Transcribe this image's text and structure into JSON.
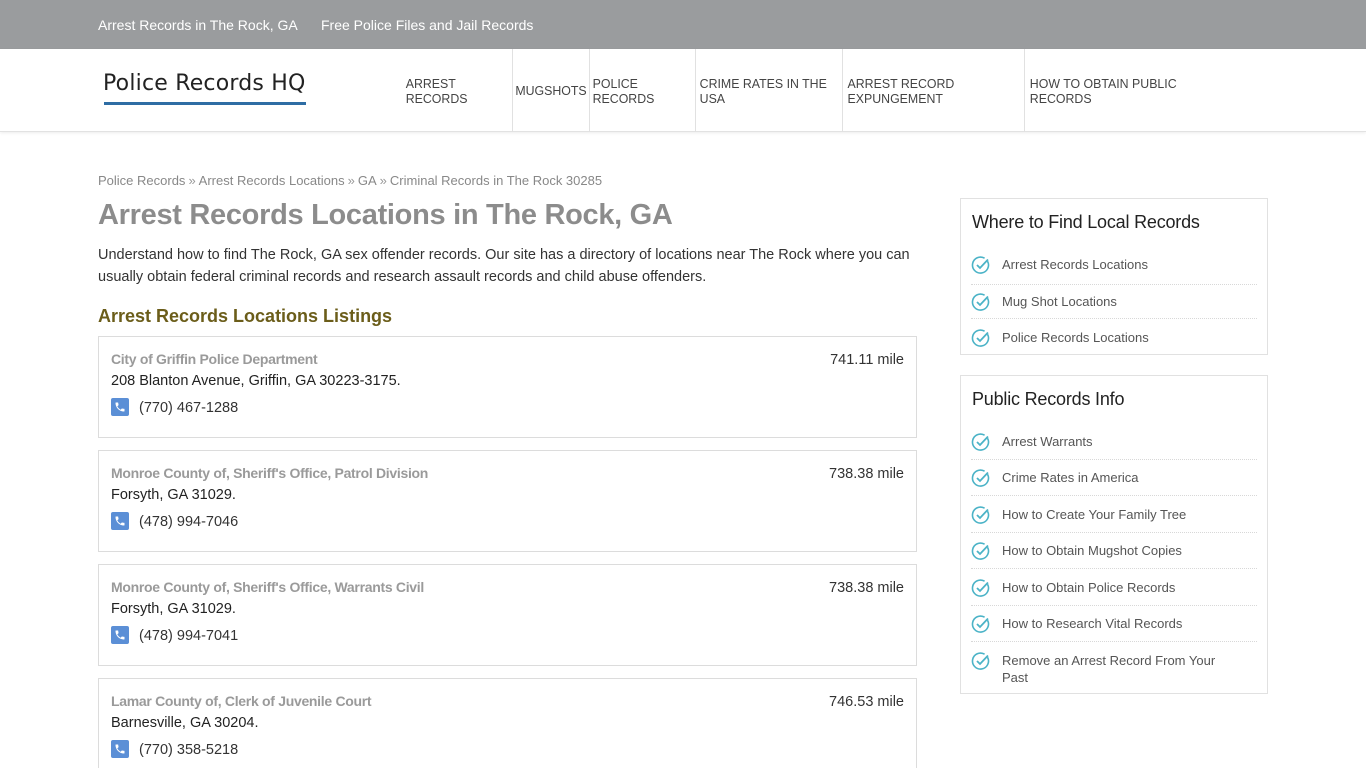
{
  "topbar": {
    "link1": "Arrest Records in The Rock, GA",
    "link2": "Free Police Files and Jail Records"
  },
  "header": {
    "logo": "Police Records HQ",
    "nav": [
      "ARREST RECORDS",
      "MUGSHOTS",
      "POLICE RECORDS",
      "CRIME RATES IN THE USA",
      "ARREST RECORD EXPUNGEMENT",
      "HOW TO OBTAIN PUBLIC RECORDS"
    ]
  },
  "breadcrumb": {
    "items": [
      "Police Records",
      "Arrest Records Locations",
      "GA",
      "Criminal Records in The Rock 30285"
    ],
    "separator": "»"
  },
  "main": {
    "title": "Arrest Records Locations in The Rock, GA",
    "intro": "Understand how to find The Rock, GA sex offender records. Our site has a directory of locations near The Rock where you can usually obtain federal criminal records and research assault records and child abuse offenders.",
    "listings_title": "Arrest Records Locations Listings",
    "listings": [
      {
        "name": "City of Griffin Police Department",
        "address": "208 Blanton Avenue, Griffin, GA 30223-3175.",
        "phone": "(770) 467-1288",
        "distance": "741.11 mile"
      },
      {
        "name": "Monroe County of, Sheriff's Office, Patrol Division",
        "address": "Forsyth, GA 31029.",
        "phone": "(478) 994-7046",
        "distance": "738.38 mile"
      },
      {
        "name": "Monroe County of, Sheriff's Office, Warrants Civil",
        "address": "Forsyth, GA 31029.",
        "phone": "(478) 994-7041",
        "distance": "738.38 mile"
      },
      {
        "name": "Lamar County of, Clerk of Juvenile Court",
        "address": "Barnesville, GA 30204.",
        "phone": "(770) 358-5218",
        "distance": "746.53 mile"
      }
    ]
  },
  "sidebar": {
    "local": {
      "title": "Where to Find Local Records",
      "items": [
        "Arrest Records Locations",
        "Mug Shot Locations",
        "Police Records Locations"
      ]
    },
    "info": {
      "title": "Public Records Info",
      "items": [
        "Arrest Warrants",
        "Crime Rates in America",
        "How to Create Your Family Tree",
        "How to Obtain Mugshot Copies",
        "How to Obtain Police Records",
        "How to Research Vital Records",
        "Remove an Arrest Record From Your Past"
      ]
    }
  },
  "colors": {
    "topbar": "#9a9c9e",
    "accent_blue": "#2e6da4",
    "check_teal": "#4bb3c7",
    "phone_icon": "#5b8fd6",
    "listings_title": "#6b5d1a"
  },
  "icons": {
    "phone": "phone-icon",
    "check": "check-circle-icon"
  }
}
